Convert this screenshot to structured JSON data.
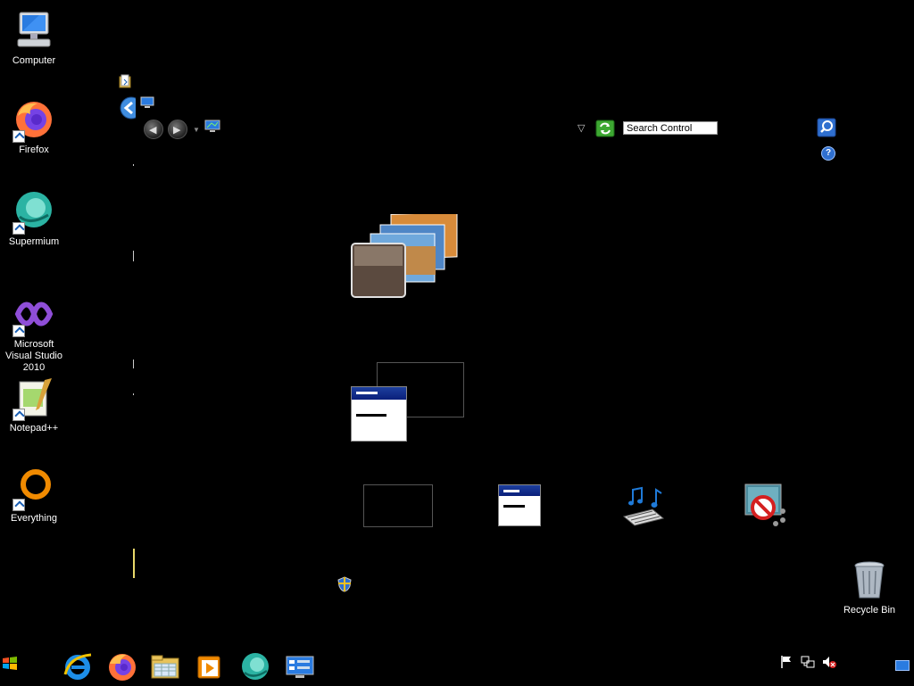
{
  "desktop": {
    "icons": [
      {
        "label": "Computer",
        "icon": "computer-icon"
      },
      {
        "label": "Firefox",
        "icon": "firefox-icon"
      },
      {
        "label": "Supermium",
        "icon": "supermium-icon"
      },
      {
        "label": "Microsoft Visual Studio 2010",
        "icon": "visual-studio-icon"
      },
      {
        "label": "Notepad++",
        "icon": "notepadpp-icon"
      },
      {
        "label": "Everything",
        "icon": "everything-icon"
      },
      {
        "label": "Recycle Bin",
        "icon": "recycle-bin-icon"
      }
    ]
  },
  "control_panel": {
    "search_placeholder": "Search Control Panel",
    "help_glyph": "?",
    "back_glyph": "◀",
    "forward_glyph": "▶",
    "dropdown_glyph": "▽"
  },
  "taskbar": {
    "pinned": [
      "internet-explorer-icon",
      "firefox-icon",
      "file-explorer-icon",
      "media-player-icon",
      "supermium-icon",
      "control-panel-icon"
    ],
    "tray": [
      "action-center-flag-icon",
      "network-icon",
      "volume-muted-icon",
      "show-desktop-icon"
    ]
  },
  "colors": {
    "background": "#000000",
    "accent_blue": "#1d3f9e",
    "firefox_orange": "#ff7139",
    "everything_orange": "#f08a00",
    "supermium_teal": "#2bb3a3"
  }
}
